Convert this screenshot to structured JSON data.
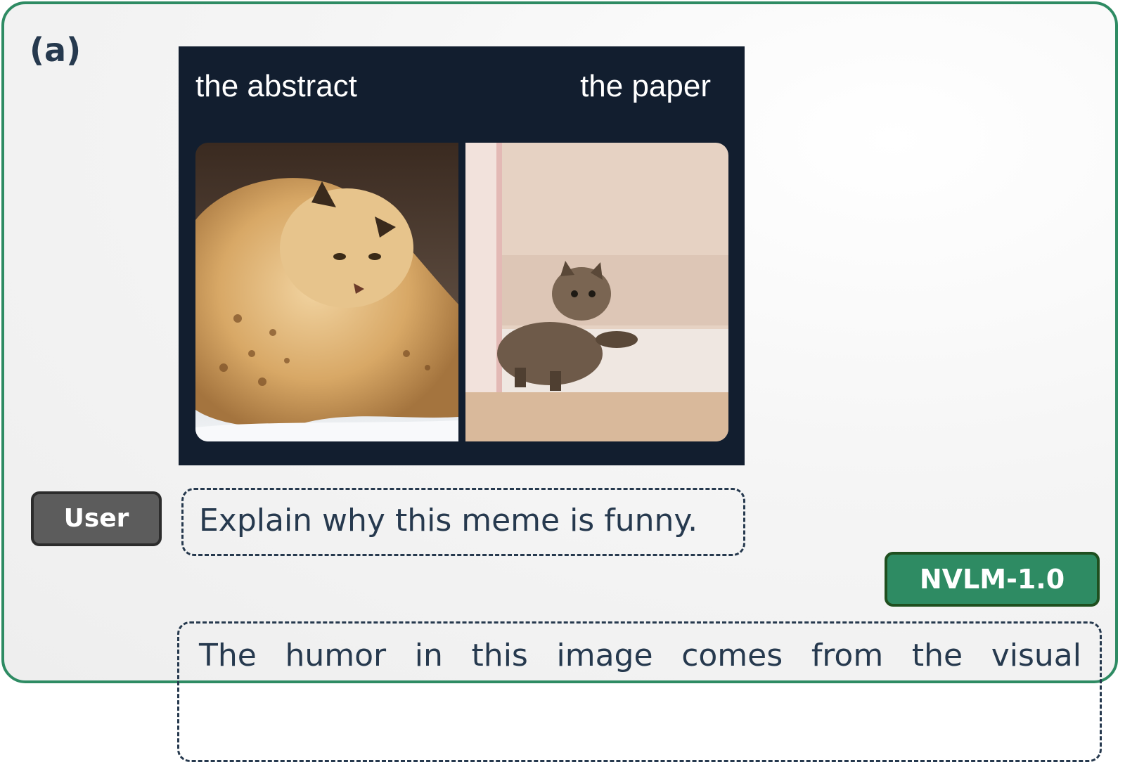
{
  "panel": {
    "label": "(a)"
  },
  "meme": {
    "left_caption": "the abstract",
    "right_caption": "the paper",
    "left_image": "lynx-pouncing-in-snow",
    "right_image": "small-tabby-cat-walking"
  },
  "conversation": {
    "user_badge": "User",
    "user_message": "Explain why this meme is funny.",
    "model_badge": "NVLM-1.0",
    "model_message": "The humor in this image comes from the visual"
  },
  "colors": {
    "frame_border": "#2e8b63",
    "text": "#26394e",
    "meme_background": "#121e2f",
    "user_badge": "#5c5c5c",
    "model_badge": "#2e8b63"
  }
}
